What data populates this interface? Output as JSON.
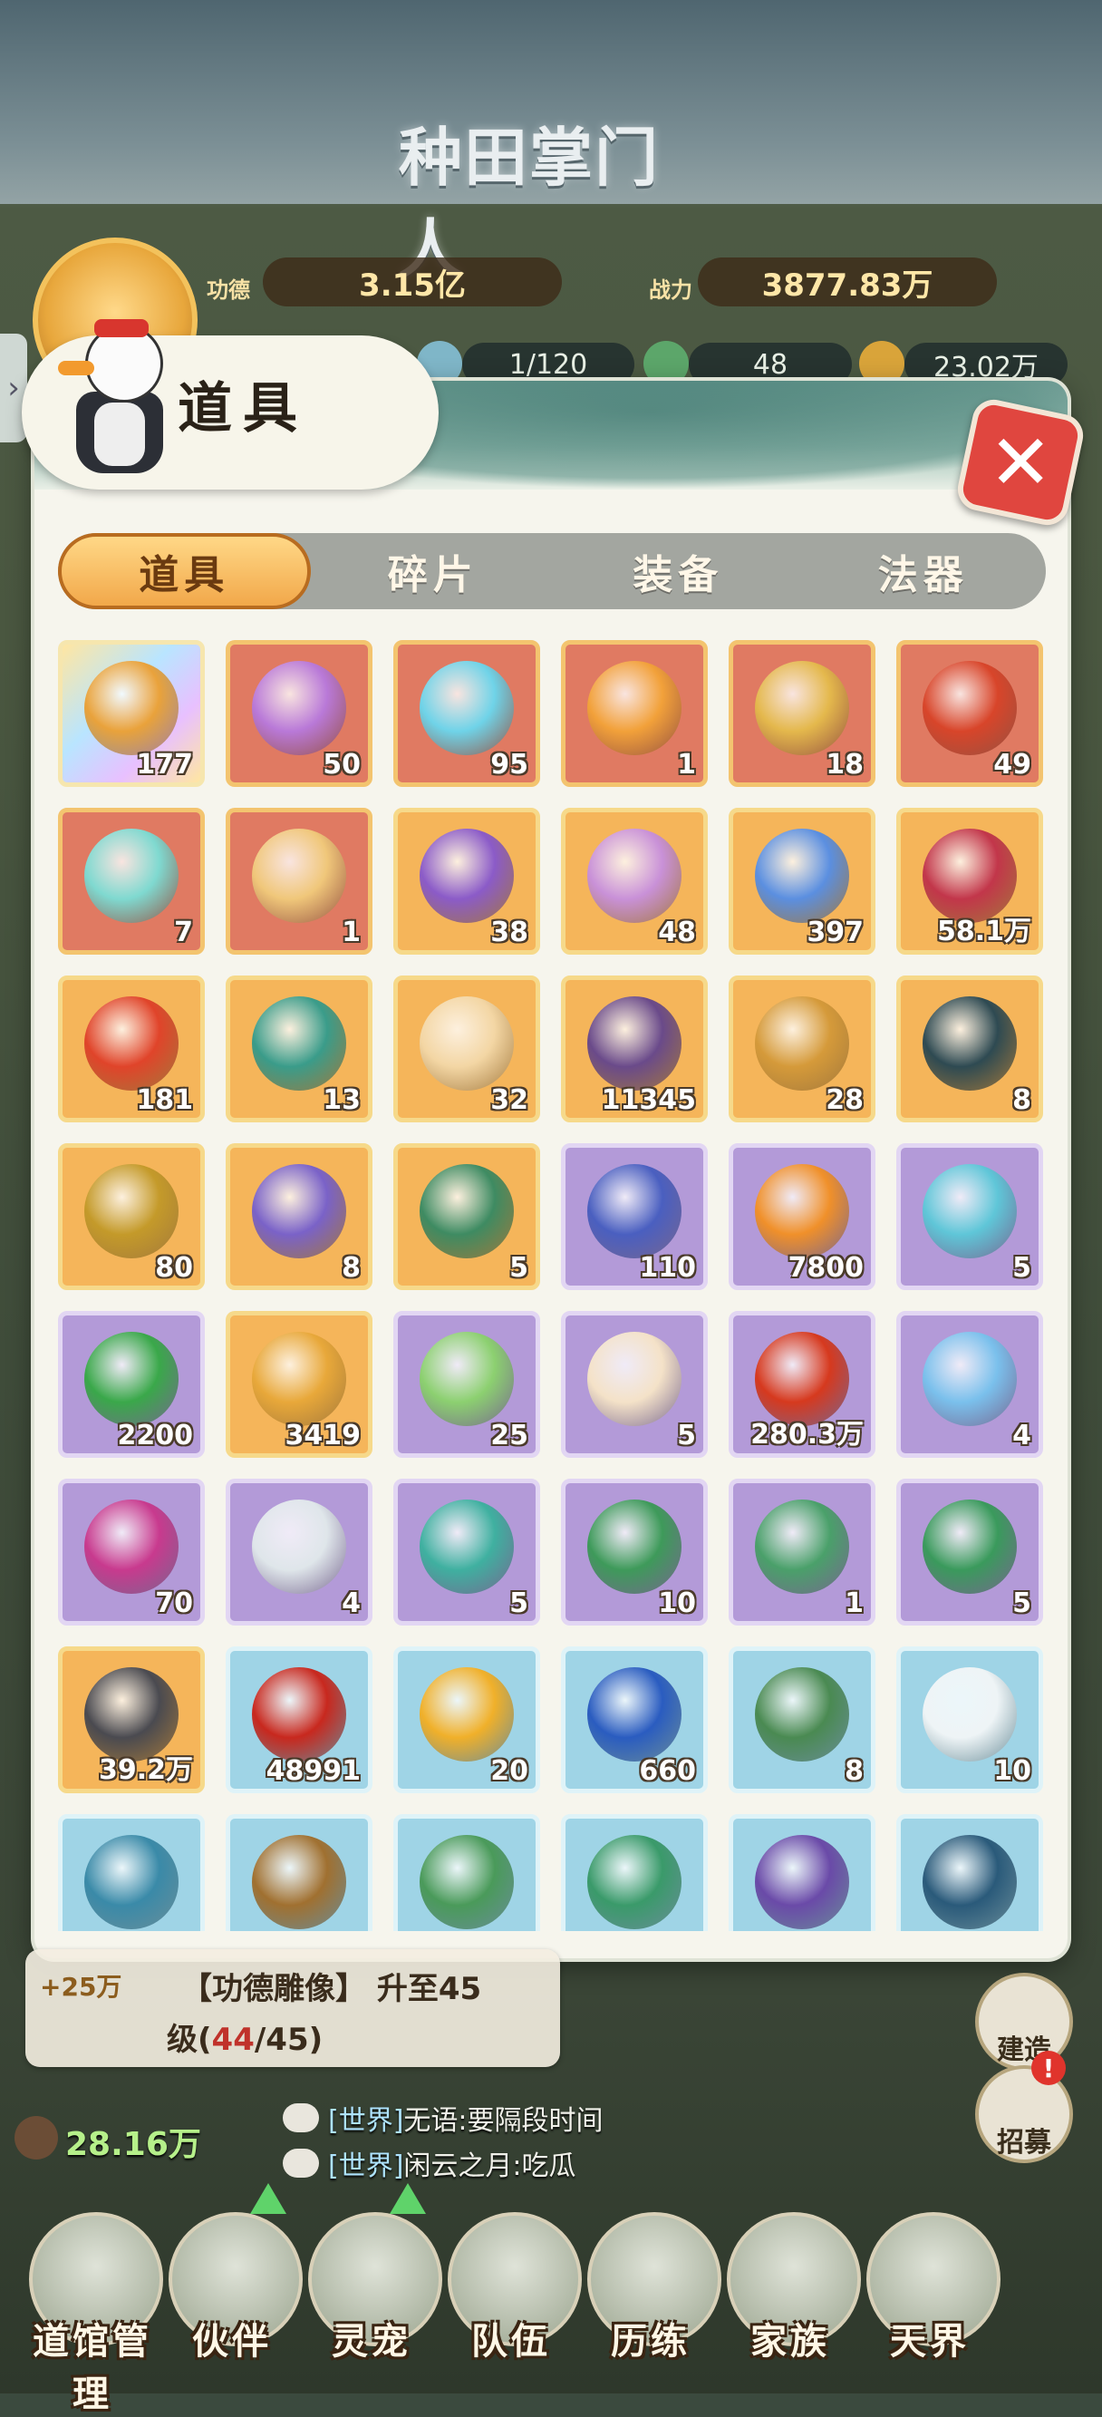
{
  "game": {
    "logo": "种田掌门人"
  },
  "player": {
    "merit_label": "功德",
    "merit_value": "3.15亿",
    "power_label": "战力",
    "power_value": "3877.83万",
    "disciples": "1/120",
    "jade": "48",
    "coins": "23.02万"
  },
  "modal": {
    "title": "道具",
    "close_label": "✕",
    "tabs": [
      {
        "label": "道具",
        "active": true
      },
      {
        "label": "碎片",
        "active": false
      },
      {
        "label": "装备",
        "active": false
      },
      {
        "label": "法器",
        "active": false
      }
    ],
    "items": [
      {
        "count": "177",
        "rarity": "rainbow",
        "color": "#e9a23b"
      },
      {
        "count": "50",
        "rarity": "red",
        "color": "#b979d8"
      },
      {
        "count": "95",
        "rarity": "red",
        "color": "#6fd3e8"
      },
      {
        "count": "1",
        "rarity": "red",
        "color": "#f2a13a"
      },
      {
        "count": "18",
        "rarity": "red",
        "color": "#e4b84c"
      },
      {
        "count": "49",
        "rarity": "red",
        "color": "#d8452a"
      },
      {
        "count": "7",
        "rarity": "red",
        "color": "#7fd9d0"
      },
      {
        "count": "1",
        "rarity": "red",
        "color": "#f0c77a"
      },
      {
        "count": "38",
        "rarity": "gold",
        "color": "#8b5bc8"
      },
      {
        "count": "48",
        "rarity": "gold",
        "color": "#c991d8"
      },
      {
        "count": "397",
        "rarity": "gold",
        "color": "#5b8fe0"
      },
      {
        "count": "58.1万",
        "rarity": "gold",
        "color": "#c2364a"
      },
      {
        "count": "181",
        "rarity": "gold",
        "color": "#e0442a"
      },
      {
        "count": "13",
        "rarity": "gold",
        "color": "#3a9c8a"
      },
      {
        "count": "32",
        "rarity": "gold",
        "color": "#f3d6a4"
      },
      {
        "count": "11345",
        "rarity": "gold",
        "color": "#6a4a8a"
      },
      {
        "count": "28",
        "rarity": "gold",
        "color": "#d59a3a"
      },
      {
        "count": "8",
        "rarity": "gold",
        "color": "#2e4a52"
      },
      {
        "count": "80",
        "rarity": "gold",
        "color": "#c49a2a"
      },
      {
        "count": "8",
        "rarity": "gold",
        "color": "#7a62c8"
      },
      {
        "count": "5",
        "rarity": "gold",
        "color": "#3e8b62"
      },
      {
        "count": "110",
        "rarity": "purple",
        "color": "#4a5fc0"
      },
      {
        "count": "7800",
        "rarity": "purple",
        "color": "#f0902a"
      },
      {
        "count": "5",
        "rarity": "purple",
        "color": "#5fc6d8"
      },
      {
        "count": "2200",
        "rarity": "purple",
        "color": "#3aa84a"
      },
      {
        "count": "3419",
        "rarity": "gold",
        "color": "#e8a83a"
      },
      {
        "count": "25",
        "rarity": "purple",
        "color": "#8cd070"
      },
      {
        "count": "5",
        "rarity": "purple",
        "color": "#f4e2c8"
      },
      {
        "count": "280.3万",
        "rarity": "purple",
        "color": "#d6391e"
      },
      {
        "count": "4",
        "rarity": "purple",
        "color": "#7ac0ec"
      },
      {
        "count": "70",
        "rarity": "purple",
        "color": "#c83a8e"
      },
      {
        "count": "4",
        "rarity": "purple",
        "color": "#dfe6ea"
      },
      {
        "count": "5",
        "rarity": "purple",
        "color": "#3fb0a0"
      },
      {
        "count": "10",
        "rarity": "purple",
        "color": "#3e9a5a"
      },
      {
        "count": "1",
        "rarity": "purple",
        "color": "#4aa06a"
      },
      {
        "count": "5",
        "rarity": "purple",
        "color": "#3a9a5c"
      },
      {
        "count": "39.2万",
        "rarity": "gold",
        "color": "#4a4a50"
      },
      {
        "count": "48991",
        "rarity": "cyan",
        "color": "#c8281e"
      },
      {
        "count": "20",
        "rarity": "cyan",
        "color": "#f0b02a"
      },
      {
        "count": "660",
        "rarity": "cyan",
        "color": "#2a5cc0"
      },
      {
        "count": "8",
        "rarity": "cyan",
        "color": "#4a8a52"
      },
      {
        "count": "10",
        "rarity": "cyan",
        "color": "#eef4f6"
      },
      {
        "count": "",
        "rarity": "cyan",
        "color": "#3a8aa8"
      },
      {
        "count": "",
        "rarity": "cyan",
        "color": "#a07030"
      },
      {
        "count": "",
        "rarity": "cyan",
        "color": "#4a9a5a"
      },
      {
        "count": "",
        "rarity": "cyan",
        "color": "#3a9a6a"
      },
      {
        "count": "",
        "rarity": "cyan",
        "color": "#6a4aa8"
      },
      {
        "count": "",
        "rarity": "cyan",
        "color": "#2a5a7a"
      }
    ]
  },
  "quest": {
    "reward": "+25万",
    "line1": "【功德雕像】 升至45",
    "line2_prefix": "级(",
    "line2_current": "44",
    "line2_suffix": "/45)"
  },
  "population": "28.16万",
  "chat": [
    {
      "channel": "[世界]",
      "text": "无语:要隔段时间"
    },
    {
      "channel": "[世界]",
      "text": "闲云之月:吃瓜"
    }
  ],
  "side_buttons": [
    {
      "label": "建造",
      "badge": ""
    },
    {
      "label": "招募",
      "badge": "!"
    }
  ],
  "nav": [
    {
      "label": "道馆管理",
      "arrow": false
    },
    {
      "label": "伙伴",
      "arrow": true
    },
    {
      "label": "灵宠",
      "arrow": true
    },
    {
      "label": "队伍",
      "arrow": false
    },
    {
      "label": "历练",
      "arrow": false
    },
    {
      "label": "家族",
      "arrow": false
    },
    {
      "label": "天界",
      "arrow": false
    }
  ]
}
